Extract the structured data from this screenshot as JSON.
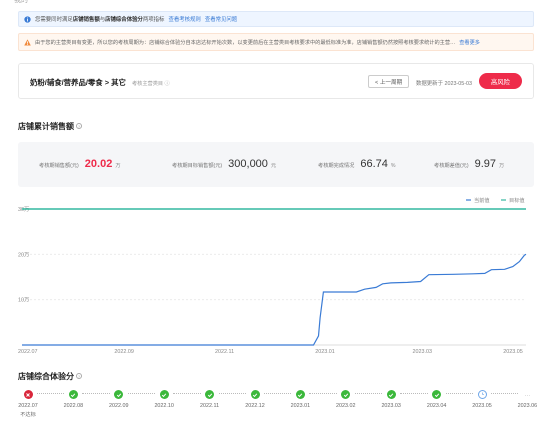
{
  "top_cut_text": "我的",
  "notice_info": {
    "part1": "您需要同时满足",
    "bold1": "店铺销售额",
    "part2": "与",
    "bold2": "店铺综合体验分",
    "part3": "两项指标",
    "link1": "查看考核规则",
    "link2": "查看常见问题"
  },
  "notice_warn": {
    "text": "由于您的主营类目有变更，所以您的考核周期为：店铺综合体验分自本店达标开始次数，以变更前后在主营类目考核要求中的最低标准为准，店铺销售额仍然按照考核要求统计的主营…",
    "link": "查看更多"
  },
  "category": {
    "title": "奶粉/辅食/营养品/零食 > 其它",
    "tip": "考核主营类目",
    "prev_label": "< 上一周期",
    "update_label": "数据更新于 2023-05-03",
    "risk_label": "高风险"
  },
  "sales_section_title": "店铺累计销售额",
  "metrics": [
    {
      "label": "考核期销售额(元)",
      "value": "20.02",
      "unit": "万"
    },
    {
      "label": "考核期目标销售额(元)",
      "value": "300,000",
      "unit": "元"
    },
    {
      "label": "考核期完成情况",
      "value": "66.74",
      "unit": "%"
    },
    {
      "label": "考核期差值(元)",
      "value": "9.97",
      "unit": "万"
    }
  ],
  "chart_data": {
    "type": "line",
    "legend": [
      "当前值",
      "目标值"
    ],
    "legend_position": "top-right",
    "y_ticks": [
      "30万",
      "20万",
      "10万"
    ],
    "x_ticks": [
      "2022.07",
      "2022.09",
      "2022.11",
      "2023.01",
      "2023.03",
      "2023.05"
    ],
    "ylim": [
      0,
      300000
    ],
    "grid": true,
    "series": [
      {
        "name": "当前值",
        "color": "#3a7bd5",
        "points": [
          [
            "2022-07-01",
            0
          ],
          [
            "2022-12-25",
            0
          ],
          [
            "2022-12-28",
            20000
          ],
          [
            "2022-12-29",
            60000
          ],
          [
            "2022-12-31",
            117000
          ],
          [
            "2023-01-20",
            117000
          ],
          [
            "2023-01-25",
            123000
          ],
          [
            "2023-02-01",
            127000
          ],
          [
            "2023-02-05",
            135000
          ],
          [
            "2023-02-10",
            137000
          ],
          [
            "2023-02-20",
            138000
          ],
          [
            "2023-02-28",
            140000
          ],
          [
            "2023-03-05",
            155000
          ],
          [
            "2023-03-20",
            156000
          ],
          [
            "2023-04-01",
            157000
          ],
          [
            "2023-04-08",
            158000
          ],
          [
            "2023-04-12",
            166000
          ],
          [
            "2023-04-20",
            167000
          ],
          [
            "2023-04-25",
            173000
          ],
          [
            "2023-04-29",
            184000
          ],
          [
            "2023-05-02",
            198000
          ],
          [
            "2023-05-03",
            200200
          ]
        ]
      },
      {
        "name": "目标值",
        "color": "#33b8a0",
        "points": [
          [
            "2022-07-01",
            300000
          ],
          [
            "2023-05-03",
            300000
          ]
        ]
      }
    ]
  },
  "score_section_title": "店铺综合体验分",
  "score_months": [
    {
      "month": "2022.07",
      "status": "fail",
      "note": "不达标"
    },
    {
      "month": "2022.08",
      "status": "pass",
      "note": ""
    },
    {
      "month": "2022.09",
      "status": "pass",
      "note": ""
    },
    {
      "month": "2022.10",
      "status": "pass",
      "note": ""
    },
    {
      "month": "2022.11",
      "status": "pass",
      "note": ""
    },
    {
      "month": "2022.12",
      "status": "pass",
      "note": ""
    },
    {
      "month": "2023.01",
      "status": "pass",
      "note": ""
    },
    {
      "month": "2023.02",
      "status": "pass",
      "note": ""
    },
    {
      "month": "2023.03",
      "status": "pass",
      "note": ""
    },
    {
      "month": "2023.04",
      "status": "pass",
      "note": ""
    },
    {
      "month": "2023.05",
      "status": "current",
      "note": ""
    },
    {
      "month": "2023.06",
      "status": "pending",
      "note": ""
    }
  ],
  "colors": {
    "accent": "#3a7bd5",
    "danger": "#ee2b4a",
    "target_line": "#33b8a0",
    "pass": "#3bb83b"
  }
}
